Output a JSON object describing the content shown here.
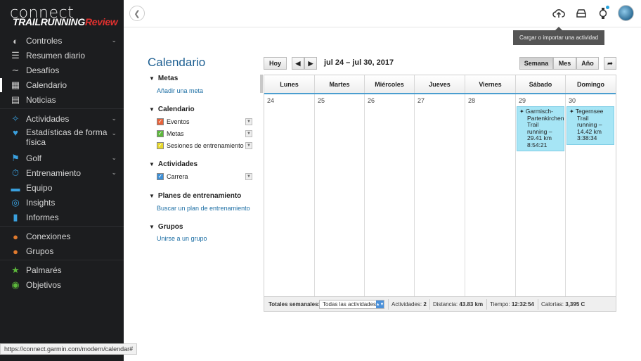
{
  "brand": {
    "logo_text": "connect",
    "overlay_prefix": "TRAILRUNNING",
    "overlay_suffix": "Review"
  },
  "sidebar": {
    "items": [
      {
        "label": "Controles",
        "icon": "dashboard-icon",
        "has_chevron": true
      },
      {
        "label": "Resumen diario",
        "icon": "layers-icon",
        "has_chevron": false
      },
      {
        "label": "Desafíos",
        "icon": "trend-icon",
        "has_chevron": false
      },
      {
        "label": "Calendario",
        "icon": "calendar-icon",
        "has_chevron": false,
        "active": true
      },
      {
        "label": "Noticias",
        "icon": "news-icon",
        "has_chevron": false
      },
      {
        "label": "Actividades",
        "icon": "activity-icon",
        "has_chevron": true
      },
      {
        "label": "Estadísticas de forma",
        "label2": "física",
        "icon": "heart-icon",
        "has_chevron": true
      },
      {
        "label": "Golf",
        "icon": "golf-icon",
        "has_chevron": true
      },
      {
        "label": "Entrenamiento",
        "icon": "stopwatch-icon",
        "has_chevron": true
      },
      {
        "label": "Equipo",
        "icon": "shoe-icon",
        "has_chevron": false
      },
      {
        "label": "Insights",
        "icon": "lightbulb-icon",
        "has_chevron": false
      },
      {
        "label": "Informes",
        "icon": "bar-chart-icon",
        "has_chevron": false
      },
      {
        "label": "Conexiones",
        "icon": "people-icon",
        "has_chevron": false
      },
      {
        "label": "Grupos",
        "icon": "group-icon",
        "has_chevron": false
      },
      {
        "label": "Palmarés",
        "icon": "trophy-icon",
        "has_chevron": false
      },
      {
        "label": "Objetivos",
        "icon": "target-icon",
        "has_chevron": false
      }
    ]
  },
  "status_url": "https://connect.garmin.com/modern/calendar#",
  "topbar": {
    "tooltip": "Cargar o importar una actividad"
  },
  "calendar": {
    "title": "Calendario",
    "sections": {
      "metas": {
        "heading": "Metas",
        "link": "Añadir una meta"
      },
      "calendario": {
        "heading": "Calendario",
        "items": [
          {
            "label": "Eventos",
            "color": "#e8623a"
          },
          {
            "label": "Metas",
            "color": "#5cb83b"
          },
          {
            "label": "Sesiones de entrenamiento",
            "color": "#e8d82a"
          }
        ]
      },
      "actividades": {
        "heading": "Actividades",
        "items": [
          {
            "label": "Carrera",
            "color": "#3d8fd6"
          }
        ]
      },
      "planes": {
        "heading": "Planes de entrenamiento",
        "link": "Buscar un plan de entrenamiento"
      },
      "grupos": {
        "heading": "Grupos",
        "link": "Unirse a un grupo"
      }
    },
    "toolbar": {
      "today": "Hoy",
      "range": "jul 24 – jul 30, 2017",
      "views": [
        "Semana",
        "Mes",
        "Año"
      ],
      "active_view": "Semana"
    },
    "days": [
      {
        "name": "Lunes",
        "num": "24"
      },
      {
        "name": "Martes",
        "num": "25"
      },
      {
        "name": "Miércoles",
        "num": "26"
      },
      {
        "name": "Jueves",
        "num": "27"
      },
      {
        "name": "Viernes",
        "num": "28"
      },
      {
        "name": "Sábado",
        "num": "29"
      },
      {
        "name": "Domingo",
        "num": "30"
      }
    ],
    "events": [
      {
        "day_index": 5,
        "lines": [
          "Garmisch-",
          "Partenkirchen",
          "Trail",
          "running –",
          "29.41 km",
          "8:54:21"
        ]
      },
      {
        "day_index": 6,
        "lines": [
          "Tegernsee",
          "Trail",
          "running –",
          "14.42 km",
          "3:38:34"
        ]
      }
    ],
    "footer": {
      "label": "Totales semanales:",
      "select_value": "Todas las actividades",
      "activities_label": "Actividades:",
      "activities_value": "2",
      "distance_label": "Distancia:",
      "distance_value": "43.83 km",
      "time_label": "Tiempo:",
      "time_value": "12:32:54",
      "calories_label": "Calorías:",
      "calories_value": "3,395 C"
    }
  }
}
